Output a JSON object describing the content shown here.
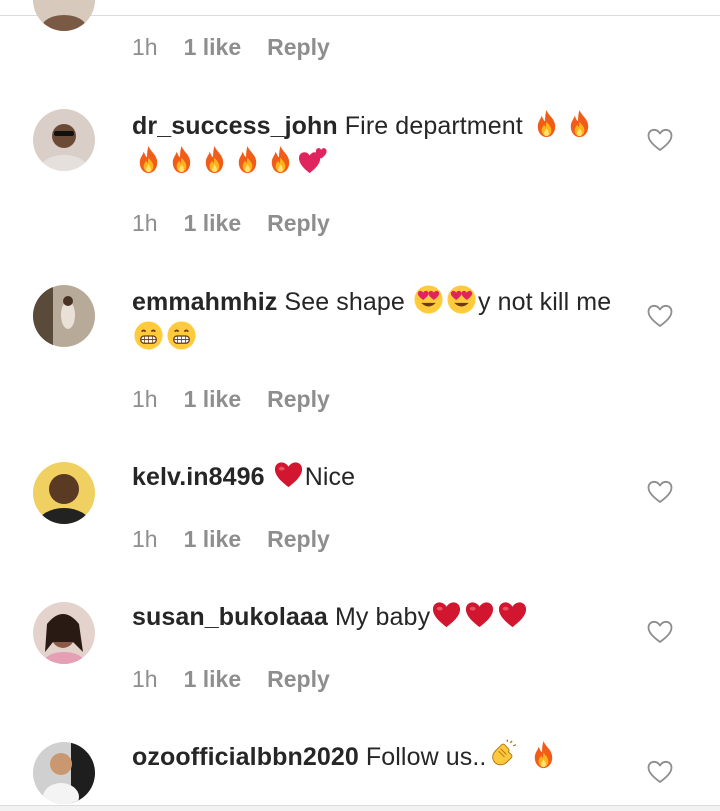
{
  "header": {
    "time": "1h",
    "likes": "1 like",
    "reply": "Reply"
  },
  "comments": [
    {
      "username": "dr_success_john",
      "segments": [
        {
          "t": "text",
          "v": " Fire department "
        },
        {
          "t": "emoji",
          "name": "fire-emoji"
        },
        {
          "t": "emoji",
          "name": "fire-emoji"
        },
        {
          "t": "emoji",
          "name": "fire-emoji"
        },
        {
          "t": "emoji",
          "name": "fire-emoji"
        },
        {
          "t": "emoji",
          "name": "fire-emoji"
        },
        {
          "t": "emoji",
          "name": "fire-emoji"
        },
        {
          "t": "emoji",
          "name": "fire-emoji"
        },
        {
          "t": "emoji",
          "name": "two-hearts-emoji"
        }
      ],
      "time": "1h",
      "likes": "1 like",
      "reply": "Reply",
      "avatar_color": "#c9b3a3"
    },
    {
      "username": "emmahmhiz",
      "segments": [
        {
          "t": "text",
          "v": " See shape "
        },
        {
          "t": "emoji",
          "name": "heart-eyes-emoji"
        },
        {
          "t": "emoji",
          "name": "heart-eyes-emoji"
        },
        {
          "t": "text",
          "v": "y not kill me "
        },
        {
          "t": "emoji",
          "name": "grinning-emoji"
        },
        {
          "t": "emoji",
          "name": "grinning-emoji"
        }
      ],
      "time": "1h",
      "likes": "1 like",
      "reply": "Reply",
      "avatar_color": "#8a7a6a"
    },
    {
      "username": "kelv.in8496",
      "segments": [
        {
          "t": "text",
          "v": " "
        },
        {
          "t": "emoji",
          "name": "red-heart-emoji"
        },
        {
          "t": "text",
          "v": "Nice"
        }
      ],
      "time": "1h",
      "likes": "1 like",
      "reply": "Reply",
      "avatar_color": "#d8a020"
    },
    {
      "username": "susan_bukolaaa",
      "segments": [
        {
          "t": "text",
          "v": " My baby"
        },
        {
          "t": "emoji",
          "name": "red-heart-emoji"
        },
        {
          "t": "emoji",
          "name": "red-heart-emoji"
        },
        {
          "t": "emoji",
          "name": "red-heart-emoji"
        }
      ],
      "time": "1h",
      "likes": "1 like",
      "reply": "Reply",
      "avatar_color": "#b07f72"
    },
    {
      "username": "ozoofficialbbn2020",
      "segments": [
        {
          "t": "text",
          "v": " Follow us.."
        },
        {
          "t": "emoji",
          "name": "clapping-hands-emoji"
        },
        {
          "t": "text",
          "v": " "
        },
        {
          "t": "emoji",
          "name": "fire-emoji"
        }
      ],
      "avatar_color": "#3a3a3a"
    }
  ],
  "colors": {
    "text": "#262626",
    "meta": "#8e8e8e",
    "heart_outline": "#8e8e8e",
    "divider": "#dbdbdb"
  }
}
